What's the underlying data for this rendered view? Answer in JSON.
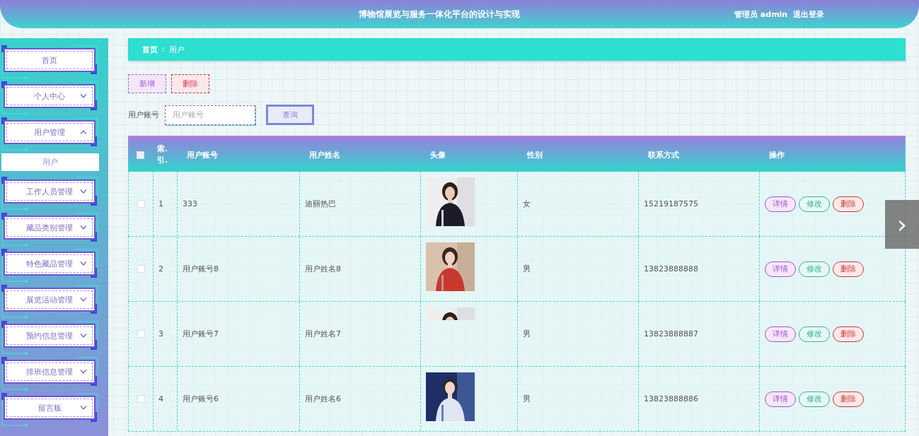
{
  "header": {
    "title": "博物馆展览与服务一体化平台的设计与实现",
    "user": "管理员 admin",
    "logout": "退出登录"
  },
  "sidebar": {
    "items": [
      {
        "label": "首页",
        "kind": "link"
      },
      {
        "label": "个人中心",
        "kind": "group",
        "expanded": false
      },
      {
        "label": "用户管理",
        "kind": "group",
        "expanded": true,
        "children": [
          {
            "label": "用户",
            "selected": true
          }
        ]
      },
      {
        "label": "工作人员管理",
        "kind": "group",
        "expanded": false
      },
      {
        "label": "藏品类别管理",
        "kind": "group",
        "expanded": false
      },
      {
        "label": "特色藏品管理",
        "kind": "group",
        "expanded": false
      },
      {
        "label": "展览活动管理",
        "kind": "group",
        "expanded": false
      },
      {
        "label": "预约信息管理",
        "kind": "group",
        "expanded": false
      },
      {
        "label": "排班信息管理",
        "kind": "group",
        "expanded": false
      },
      {
        "label": "留言板",
        "kind": "group",
        "expanded": false
      }
    ]
  },
  "breadcrumb": {
    "items": [
      "首页",
      "用户"
    ],
    "separator": "⁝"
  },
  "toolbar": {
    "buttons": [
      {
        "label": "新增",
        "kind": "add"
      },
      {
        "label": "删除",
        "kind": "delete"
      }
    ]
  },
  "search": {
    "label": "用户账号",
    "placeholder": "用户账号",
    "button": "查询"
  },
  "table": {
    "columns": [
      "索.引.",
      "用户账号",
      "用户姓名",
      "头像",
      "性别",
      "联系方式",
      "操作"
    ],
    "header_checked": false,
    "rows": [
      {
        "checked": false,
        "index": "1",
        "account": "333",
        "name": "迪丽热巴",
        "avatar": {
          "kind": "picture",
          "cropped": false
        },
        "gender": "女",
        "phone": "15219187575",
        "actions": [
          {
            "label": "详情",
            "kind": "detail"
          },
          {
            "label": "修改",
            "kind": "edit"
          },
          {
            "label": "删除",
            "kind": "delete"
          }
        ]
      },
      {
        "checked": false,
        "index": "2",
        "account": "用户账号8",
        "name": "用户姓名8",
        "avatar": {
          "kind": "picture",
          "cropped": false
        },
        "gender": "男",
        "phone": "13823888888",
        "actions": [
          {
            "label": "详情",
            "kind": "detail"
          },
          {
            "label": "修改",
            "kind": "edit"
          },
          {
            "label": "删除",
            "kind": "delete"
          }
        ]
      },
      {
        "checked": false,
        "index": "3",
        "account": "用户账号7",
        "name": "用户姓名7",
        "avatar": {
          "kind": "picture",
          "cropped": true
        },
        "gender": "男",
        "phone": "13823888887",
        "actions": [
          {
            "label": "详情",
            "kind": "detail"
          },
          {
            "label": "修改",
            "kind": "edit"
          },
          {
            "label": "删除",
            "kind": "delete"
          }
        ]
      },
      {
        "checked": false,
        "index": "4",
        "account": "用户账号6",
        "name": "用户姓名6",
        "avatar": {
          "kind": "picture",
          "cropped": false
        },
        "gender": "男",
        "phone": "13823888886",
        "actions": [
          {
            "label": "详情",
            "kind": "detail"
          },
          {
            "label": "修改",
            "kind": "edit"
          },
          {
            "label": "删除",
            "kind": "delete"
          }
        ]
      }
    ]
  },
  "pager": {
    "next": "›"
  }
}
